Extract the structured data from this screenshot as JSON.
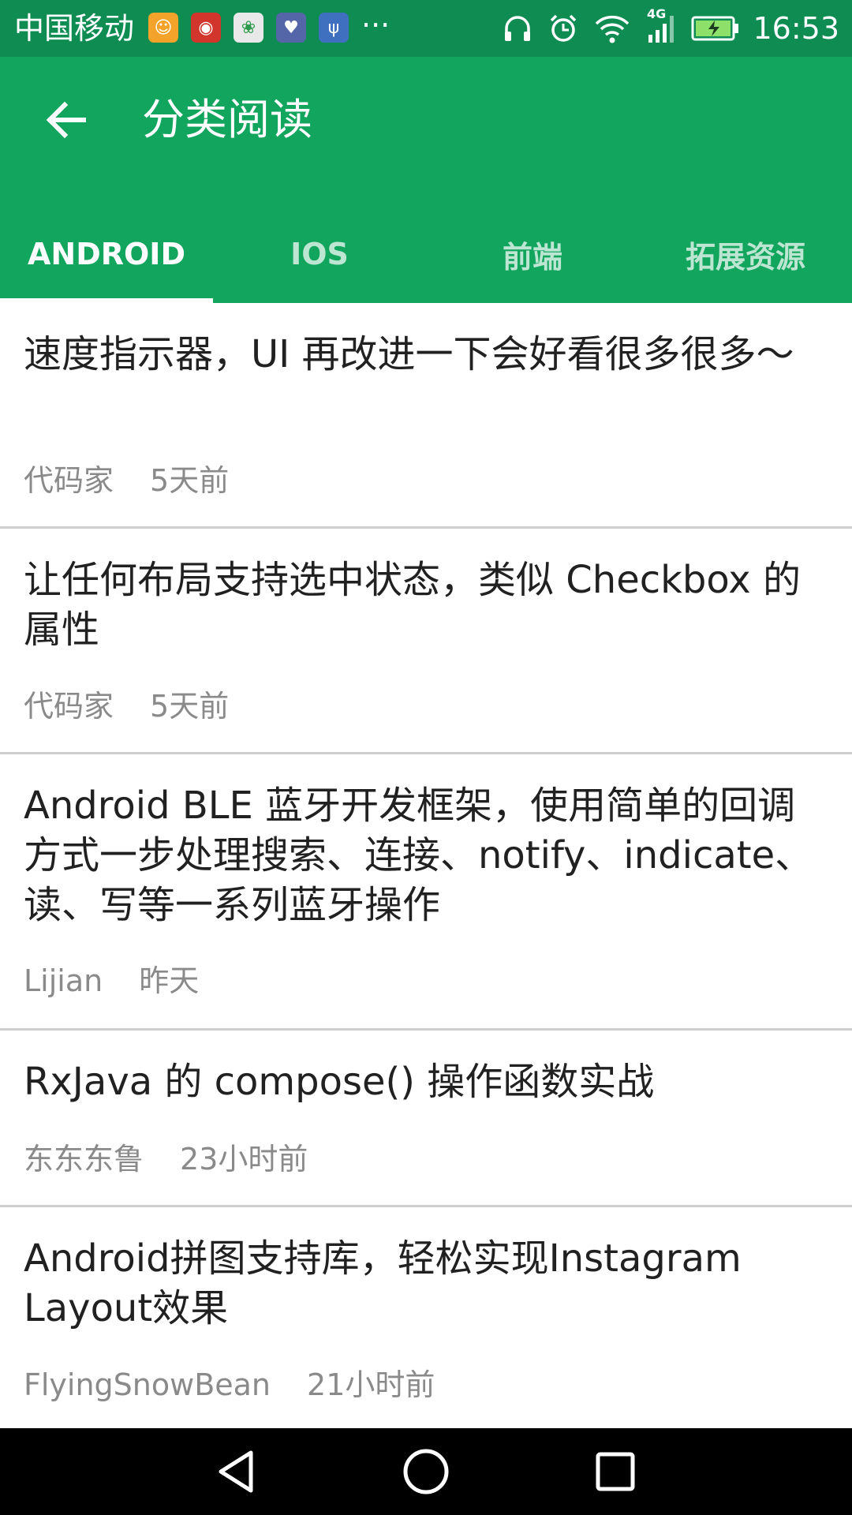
{
  "status_bar": {
    "carrier": "中国移动",
    "more": "···",
    "time": "16:53",
    "network": "4G",
    "notification_icons": [
      {
        "name": "uc-browser-icon",
        "color": "#f3a22a"
      },
      {
        "name": "netease-music-icon",
        "color": "#d1352b"
      },
      {
        "name": "colorful-app-icon",
        "color": "#eeeeee"
      },
      {
        "name": "health-monitor-icon",
        "color": "#5566a8"
      },
      {
        "name": "usb-icon",
        "color": "#3f6fbf"
      }
    ]
  },
  "app_bar": {
    "title": "分类阅读",
    "tabs": [
      {
        "label": "ANDROID",
        "active": true
      },
      {
        "label": "IOS",
        "active": false
      },
      {
        "label": "前端",
        "active": false
      },
      {
        "label": "拓展资源",
        "active": false
      }
    ]
  },
  "articles": [
    {
      "title": "速度指示器，UI 再改进一下会好看很多很多～",
      "author": "代码家",
      "time": "5天前"
    },
    {
      "title": "让任何布局支持选中状态，类似 Checkbox 的属性",
      "author": "代码家",
      "time": "5天前"
    },
    {
      "title": "Android BLE 蓝牙开发框架，使用简单的回调方式一步处理搜索、连接、notify、indicate、读、写等一系列蓝牙操作",
      "author": "Lijian",
      "time": "昨天"
    },
    {
      "title": "RxJava 的 compose() 操作函数实战",
      "author": "东东东鲁",
      "time": "23小时前"
    },
    {
      "title": "Android拼图支持库，轻松实现Instagram Layout效果",
      "author": "FlyingSnowBean",
      "time": "21小时前"
    }
  ],
  "colors": {
    "primary": "#12a55e",
    "status_bar": "#0e8c52"
  }
}
